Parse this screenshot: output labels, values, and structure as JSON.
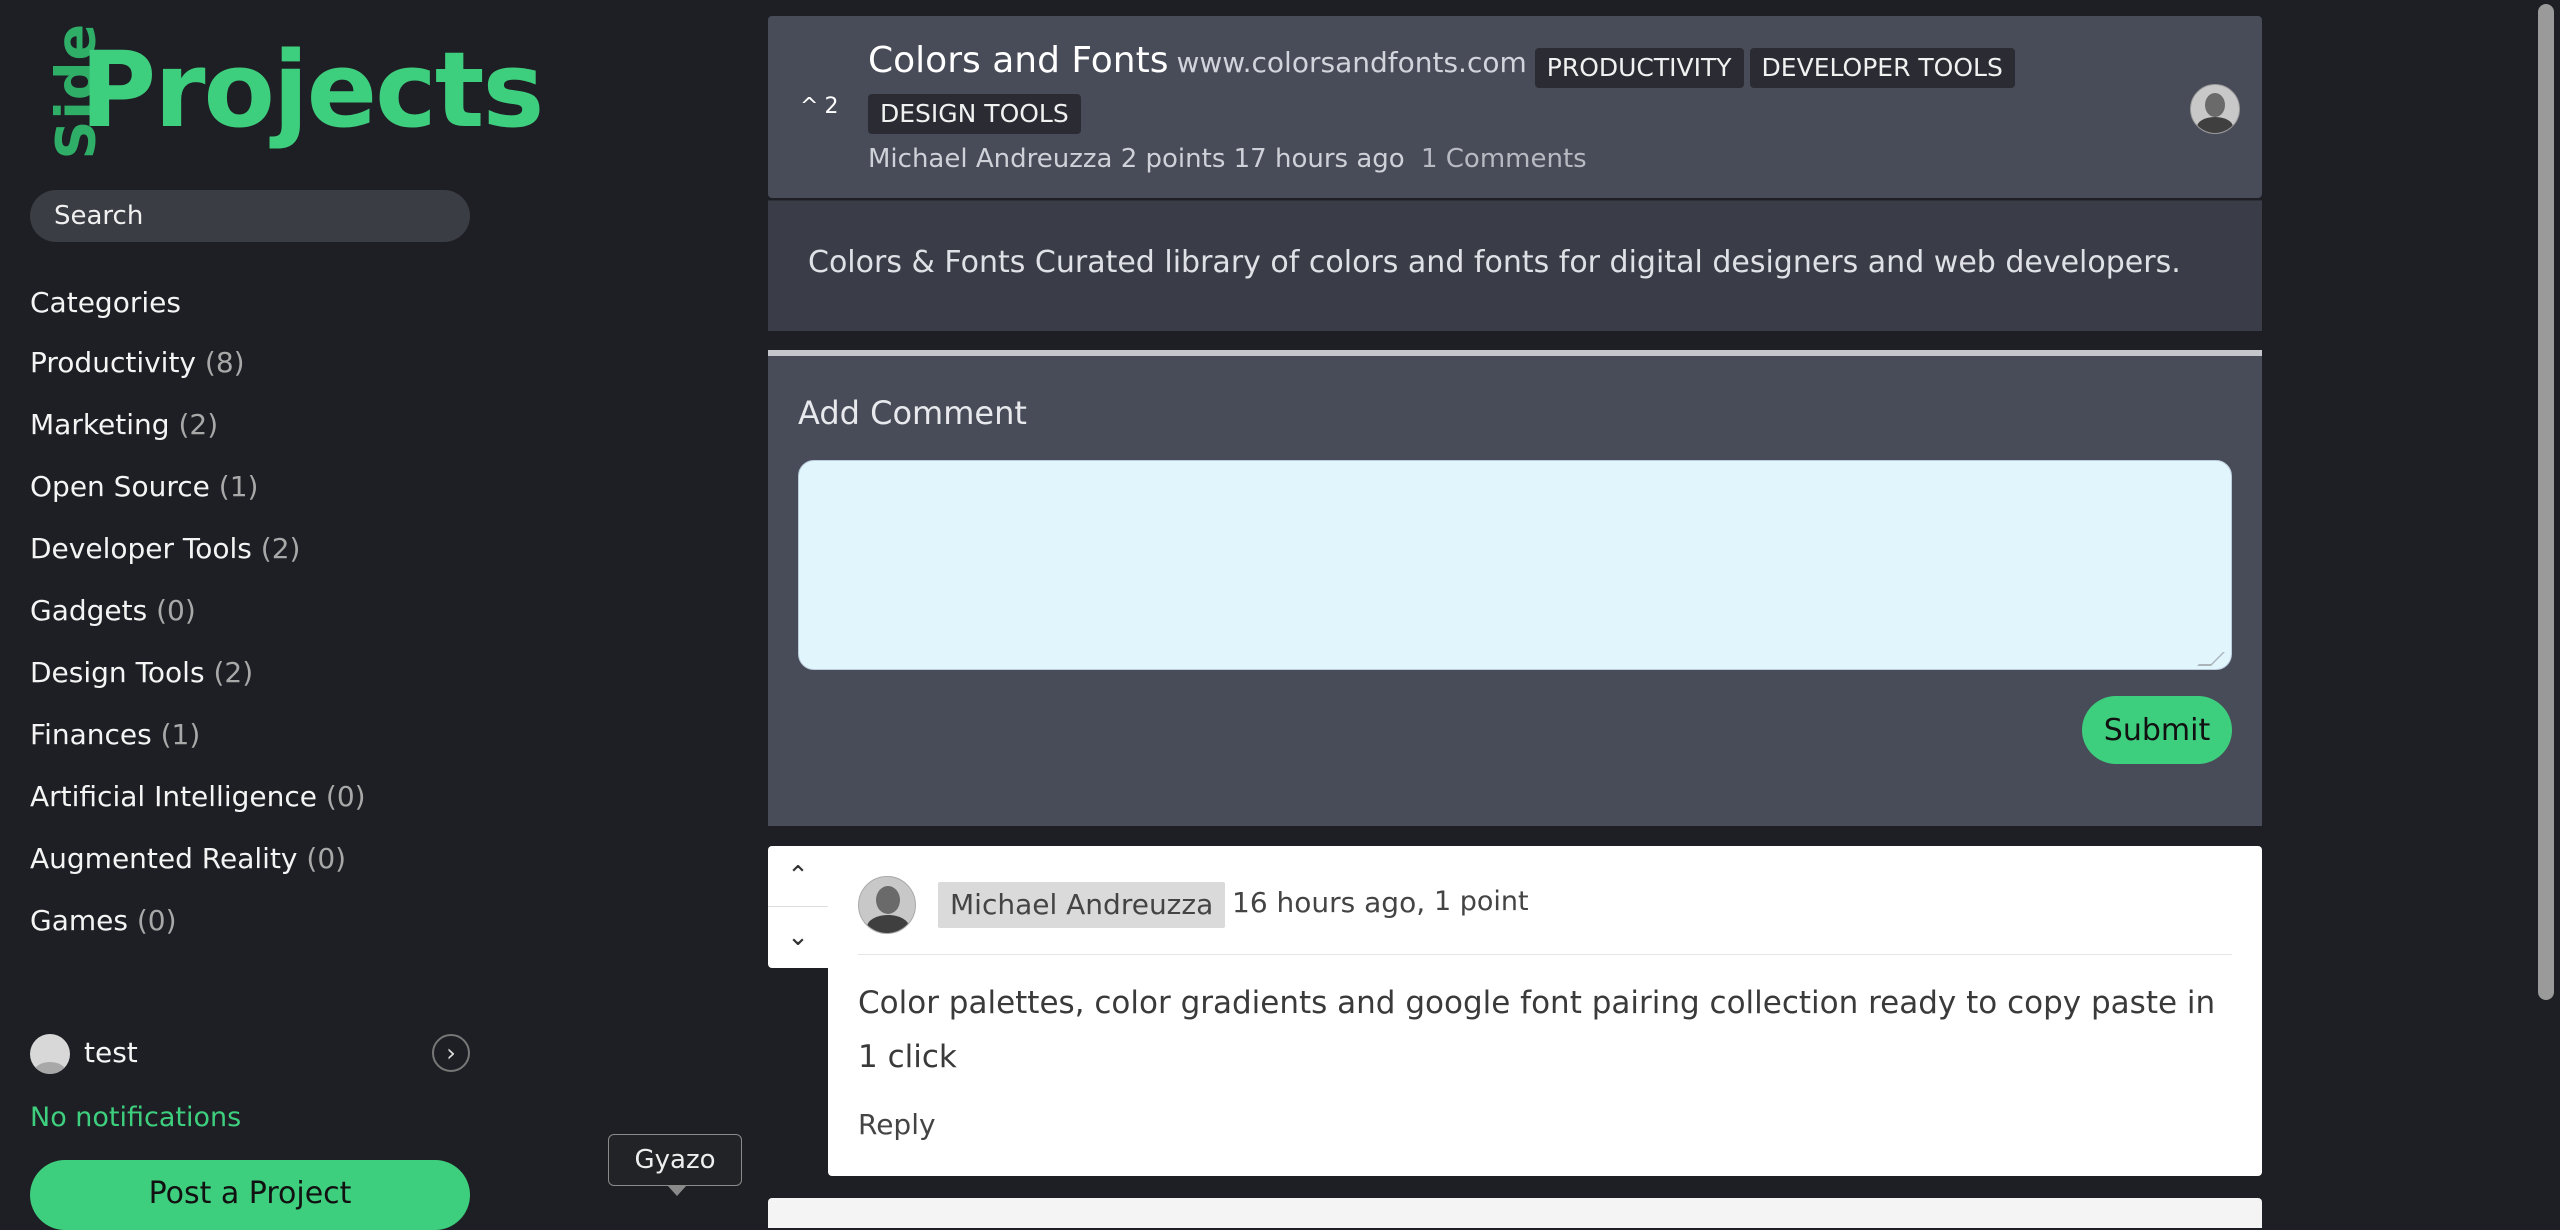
{
  "brand": {
    "side": "Side",
    "projects": "Projects"
  },
  "search": {
    "placeholder": "Search"
  },
  "sidebar": {
    "categories_heading": "Categories",
    "categories": [
      {
        "name": "Productivity",
        "count": "(8)"
      },
      {
        "name": "Marketing",
        "count": "(2)"
      },
      {
        "name": "Open Source",
        "count": "(1)"
      },
      {
        "name": "Developer Tools",
        "count": "(2)"
      },
      {
        "name": "Gadgets",
        "count": "(0)"
      },
      {
        "name": "Design Tools",
        "count": "(2)"
      },
      {
        "name": "Finances",
        "count": "(1)"
      },
      {
        "name": "Artificial Intelligence",
        "count": "(0)"
      },
      {
        "name": "Augmented Reality",
        "count": "(0)"
      },
      {
        "name": "Games",
        "count": "(0)"
      }
    ],
    "user": {
      "name": "test",
      "toggle_icon": "›"
    },
    "notifications": "No notifications",
    "post_button": "Post a Project"
  },
  "tooltip": {
    "label": "Gyazo"
  },
  "post": {
    "votes": "2",
    "vote_icon": "^",
    "title": "Colors and Fonts",
    "url": "www.colorsandfonts.com",
    "tags": [
      "PRODUCTIVITY",
      "DEVELOPER TOOLS",
      "DESIGN TOOLS"
    ],
    "author": "Michael Andreuzza",
    "points_time": "2 points 17 hours ago",
    "comments": "1 Comments",
    "description": "Colors & Fonts Curated library of colors and fonts for digital designers and web developers."
  },
  "comment_form": {
    "title": "Add Comment",
    "value": "",
    "submit": "Submit"
  },
  "comments": [
    {
      "author": "Michael Andreuzza",
      "time": "16 hours ago,",
      "points": "1 point",
      "body": "Color palettes, color gradients and google font pairing collection ready to copy paste in 1 click",
      "reply": "Reply",
      "upvote_icon": "⌃",
      "downvote_icon": "⌄"
    }
  ],
  "colors": {
    "accent": "#3ecf7e",
    "background": "#1e1f24",
    "card": "#484b58",
    "input": "#e1f5fd"
  }
}
